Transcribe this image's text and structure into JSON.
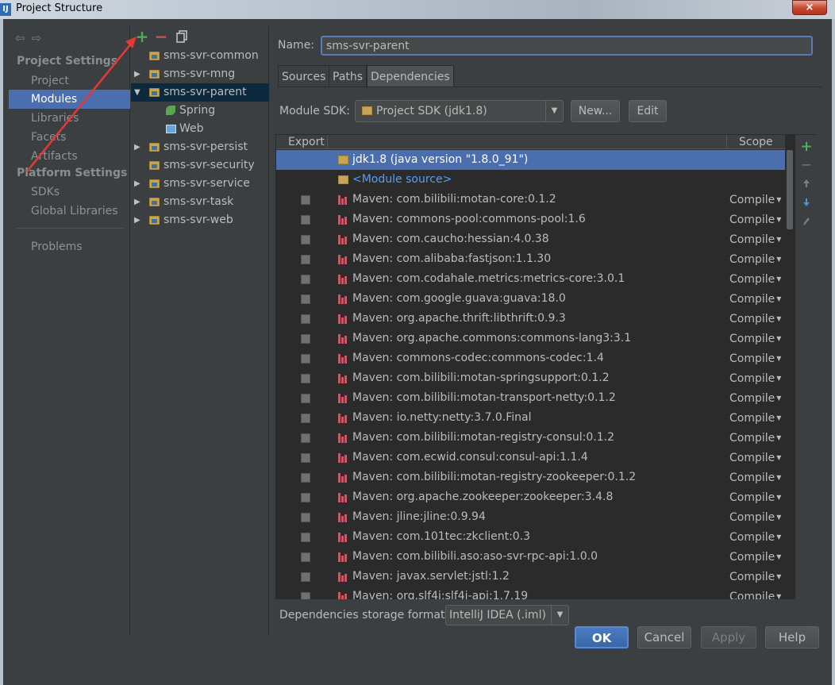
{
  "window": {
    "title": "Project Structure",
    "app_icon_text": "IJ",
    "close_glyph": "×"
  },
  "nav": {
    "back_icon": "back-arrow-icon",
    "forward_icon": "forward-arrow-icon",
    "project_settings_header": "Project Settings",
    "project_settings": [
      {
        "label": "Project",
        "selected": false
      },
      {
        "label": "Modules",
        "selected": true
      },
      {
        "label": "Libraries",
        "selected": false
      },
      {
        "label": "Facets",
        "selected": false
      },
      {
        "label": "Artifacts",
        "selected": false
      }
    ],
    "platform_settings_header": "Platform Settings",
    "platform_settings": [
      {
        "label": "SDKs"
      },
      {
        "label": "Global Libraries"
      }
    ],
    "problems": "Problems"
  },
  "tree_toolbar": {
    "add": "+",
    "remove": "−",
    "copy_icon": "copy-icon"
  },
  "tree": [
    {
      "label": "sms-svr-common",
      "expandable": false,
      "level": 0
    },
    {
      "label": "sms-svr-mng",
      "expandable": true,
      "expanded": false,
      "level": 0
    },
    {
      "label": "sms-svr-parent",
      "expandable": true,
      "expanded": true,
      "level": 0,
      "selected": true
    },
    {
      "label": "Spring",
      "level": 1,
      "icon": "spring-icon"
    },
    {
      "label": "Web",
      "level": 1,
      "icon": "web-icon"
    },
    {
      "label": "sms-svr-persist",
      "expandable": true,
      "expanded": false,
      "level": 0
    },
    {
      "label": "sms-svr-security",
      "expandable": false,
      "level": 0
    },
    {
      "label": "sms-svr-service",
      "expandable": true,
      "expanded": false,
      "level": 0
    },
    {
      "label": "sms-svr-task",
      "expandable": true,
      "expanded": false,
      "level": 0
    },
    {
      "label": "sms-svr-web",
      "expandable": true,
      "expanded": false,
      "level": 0
    }
  ],
  "main": {
    "name_label": "Name:",
    "name_value": "sms-svr-parent",
    "tabs": [
      {
        "label": "Sources",
        "active": false
      },
      {
        "label": "Paths",
        "active": false
      },
      {
        "label": "Dependencies",
        "active": true
      }
    ],
    "module_sdk_label": "Module SDK:",
    "module_sdk_value": "Project SDK (jdk1.8)",
    "new_button": "New...",
    "edit_button": "Edit",
    "table_headers": {
      "export": "Export",
      "scope": "Scope"
    },
    "dependencies": [
      {
        "label": "jdk1.8 (java version \"1.8.0_91\")",
        "kind": "sdk",
        "selected": true
      },
      {
        "label": "<Module source>",
        "kind": "source"
      },
      {
        "label": "Maven: com.bilibili:motan-core:0.1.2",
        "scope": "Compile"
      },
      {
        "label": "Maven: commons-pool:commons-pool:1.6",
        "scope": "Compile"
      },
      {
        "label": "Maven: com.caucho:hessian:4.0.38",
        "scope": "Compile"
      },
      {
        "label": "Maven: com.alibaba:fastjson:1.1.30",
        "scope": "Compile"
      },
      {
        "label": "Maven: com.codahale.metrics:metrics-core:3.0.1",
        "scope": "Compile"
      },
      {
        "label": "Maven: com.google.guava:guava:18.0",
        "scope": "Compile"
      },
      {
        "label": "Maven: org.apache.thrift:libthrift:0.9.3",
        "scope": "Compile"
      },
      {
        "label": "Maven: org.apache.commons:commons-lang3:3.1",
        "scope": "Compile"
      },
      {
        "label": "Maven: commons-codec:commons-codec:1.4",
        "scope": "Compile"
      },
      {
        "label": "Maven: com.bilibili:motan-springsupport:0.1.2",
        "scope": "Compile"
      },
      {
        "label": "Maven: com.bilibili:motan-transport-netty:0.1.2",
        "scope": "Compile"
      },
      {
        "label": "Maven: io.netty:netty:3.7.0.Final",
        "scope": "Compile"
      },
      {
        "label": "Maven: com.bilibili:motan-registry-consul:0.1.2",
        "scope": "Compile"
      },
      {
        "label": "Maven: com.ecwid.consul:consul-api:1.1.4",
        "scope": "Compile"
      },
      {
        "label": "Maven: com.bilibili:motan-registry-zookeeper:0.1.2",
        "scope": "Compile"
      },
      {
        "label": "Maven: org.apache.zookeeper:zookeeper:3.4.8",
        "scope": "Compile"
      },
      {
        "label": "Maven: jline:jline:0.9.94",
        "scope": "Compile"
      },
      {
        "label": "Maven: com.101tec:zkclient:0.3",
        "scope": "Compile"
      },
      {
        "label": "Maven: com.bilibili.aso:aso-svr-rpc-api:1.0.0",
        "scope": "Compile"
      },
      {
        "label": "Maven: javax.servlet:jstl:1.2",
        "scope": "Compile"
      },
      {
        "label": "Maven: org.slf4j:slf4j-api:1.7.19",
        "scope": "Compile"
      }
    ],
    "side_tools": {
      "add": "+",
      "remove": "−"
    },
    "storage_label": "Dependencies storage format:",
    "storage_value": "IntelliJ IDEA (.iml)"
  },
  "buttons": {
    "ok": "OK",
    "cancel": "Cancel",
    "apply": "Apply",
    "help": "Help"
  },
  "colors": {
    "selection": "#4b6eaf",
    "add_green": "#4caf50",
    "remove_red": "#c75450",
    "annotation_arrow": "#e53935"
  }
}
